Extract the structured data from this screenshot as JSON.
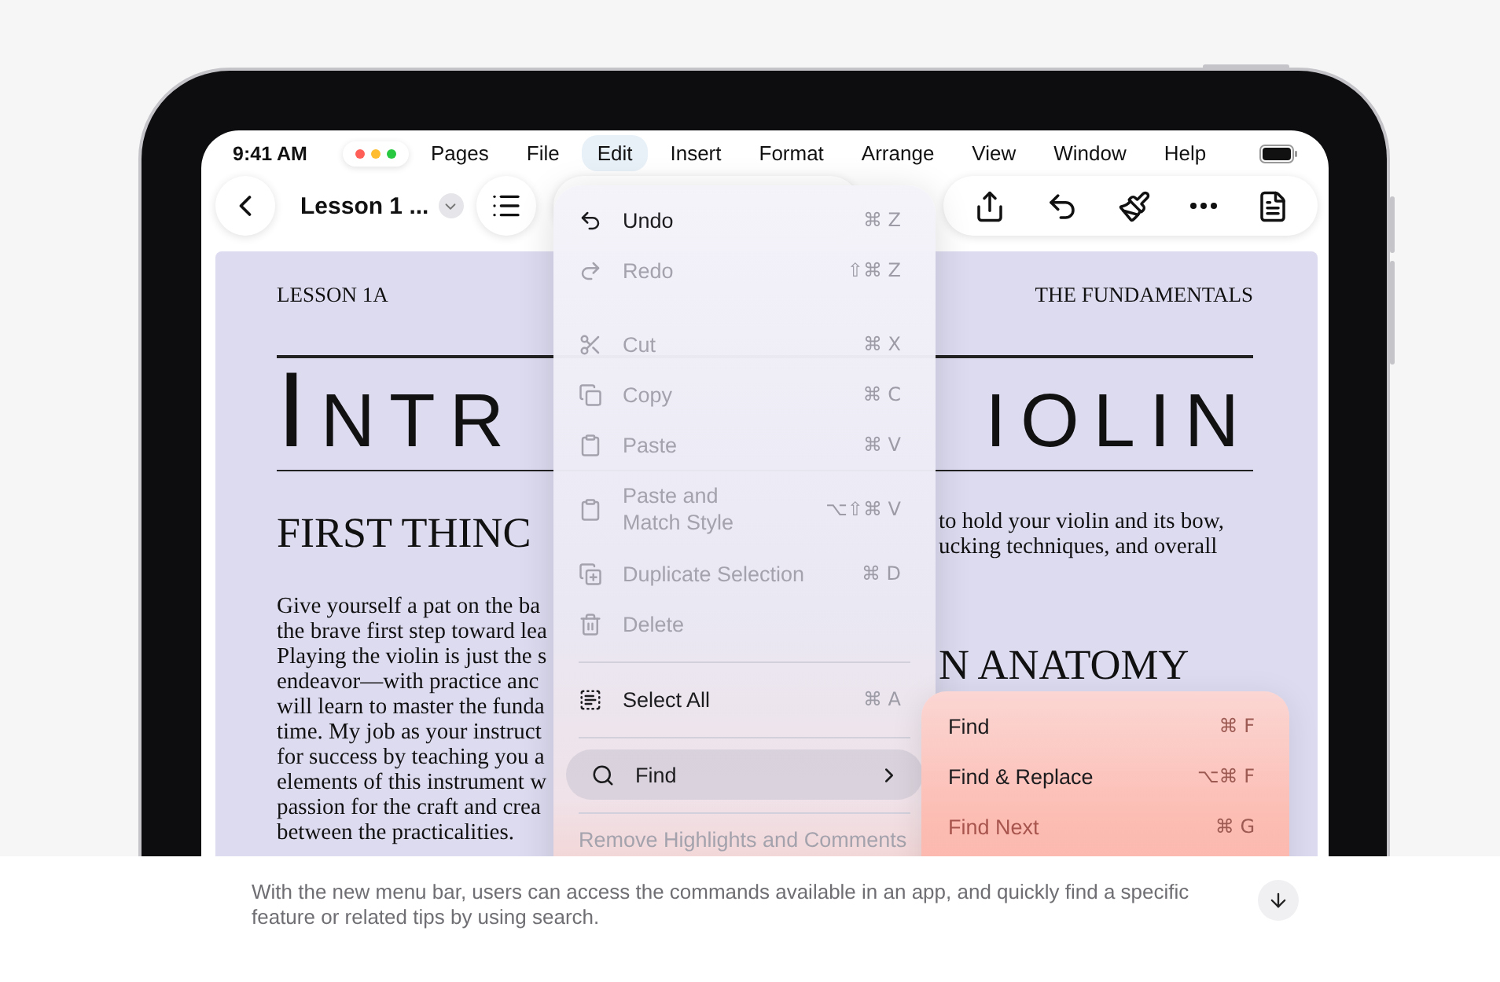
{
  "status_bar": {
    "time": "9:41 AM"
  },
  "menu_bar": {
    "items": [
      {
        "label": "Pages",
        "selected": false
      },
      {
        "label": "File",
        "selected": false
      },
      {
        "label": "Edit",
        "selected": true
      },
      {
        "label": "Insert",
        "selected": false
      },
      {
        "label": "Format",
        "selected": false
      },
      {
        "label": "Arrange",
        "selected": false
      },
      {
        "label": "View",
        "selected": false
      },
      {
        "label": "Window",
        "selected": false
      },
      {
        "label": "Help",
        "selected": false
      }
    ]
  },
  "toolbar": {
    "document_title": "Lesson 1 ..."
  },
  "document": {
    "header_left": "LESSON 1A",
    "header_right": "THE FUNDAMENTALS",
    "title_left": "Intr",
    "title_right": "iolin",
    "left_heading": "FIRST THINC",
    "left_lines": [
      "Give yourself a pat on the ba",
      "the brave first step toward lea",
      "Playing the violin is just the s",
      "endeavor—with practice anc",
      "will learn to master the funda",
      "time. My job as your instruct",
      "for success by teaching you a",
      "elements of this instrument w",
      "passion for the craft and crea",
      "between the practicalities."
    ],
    "right_lines": [
      "to hold your violin and its bow,",
      "ucking techniques, and overall"
    ],
    "right_heading": "N ANATOMY"
  },
  "edit_menu": {
    "sections": [
      {
        "divider": false,
        "items": [
          {
            "label": "Undo",
            "shortcut": "⌘ Z",
            "disabled": false,
            "selected": false
          },
          {
            "label": "Redo",
            "shortcut": "⇧⌘ Z",
            "disabled": true,
            "selected": false
          }
        ]
      },
      {
        "divider": false,
        "items": [
          {
            "label": "Cut",
            "shortcut": "⌘ X",
            "disabled": true,
            "selected": false
          },
          {
            "label": "Copy",
            "shortcut": "⌘ C",
            "disabled": true,
            "selected": false
          },
          {
            "label": "Paste",
            "shortcut": "⌘ V",
            "disabled": true,
            "selected": false
          },
          {
            "label": "Paste and\nMatch Style",
            "shortcut": "⌥⇧⌘ V",
            "disabled": true,
            "selected": false
          },
          {
            "label": "Duplicate Selection",
            "shortcut": "⌘ D",
            "disabled": true,
            "selected": false
          },
          {
            "label": "Delete",
            "disabled": true,
            "selected": false
          }
        ]
      },
      {
        "divider": true,
        "items": [
          {
            "label": "Select All",
            "shortcut": "⌘ A",
            "disabled": false,
            "selected": false
          }
        ]
      },
      {
        "divider": true,
        "items": [
          {
            "label": "Find",
            "disabled": false,
            "selected": true,
            "has_submenu": true
          }
        ]
      },
      {
        "divider": true,
        "items": [
          {
            "label": "Remove Highlights and Comments",
            "disabled": true,
            "selected": false
          }
        ]
      }
    ]
  },
  "find_submenu": {
    "items": [
      {
        "label": "Find",
        "shortcut": "⌘ F",
        "disabled": false
      },
      {
        "label": "Find & Replace",
        "shortcut": "⌥⌘ F",
        "disabled": false
      },
      {
        "label": "Find Next",
        "shortcut": "⌘ G",
        "disabled": true
      }
    ]
  },
  "caption": {
    "text": "With the new menu bar, users can access the commands available in an app, and quickly find a specific feature or related tips by using search."
  }
}
